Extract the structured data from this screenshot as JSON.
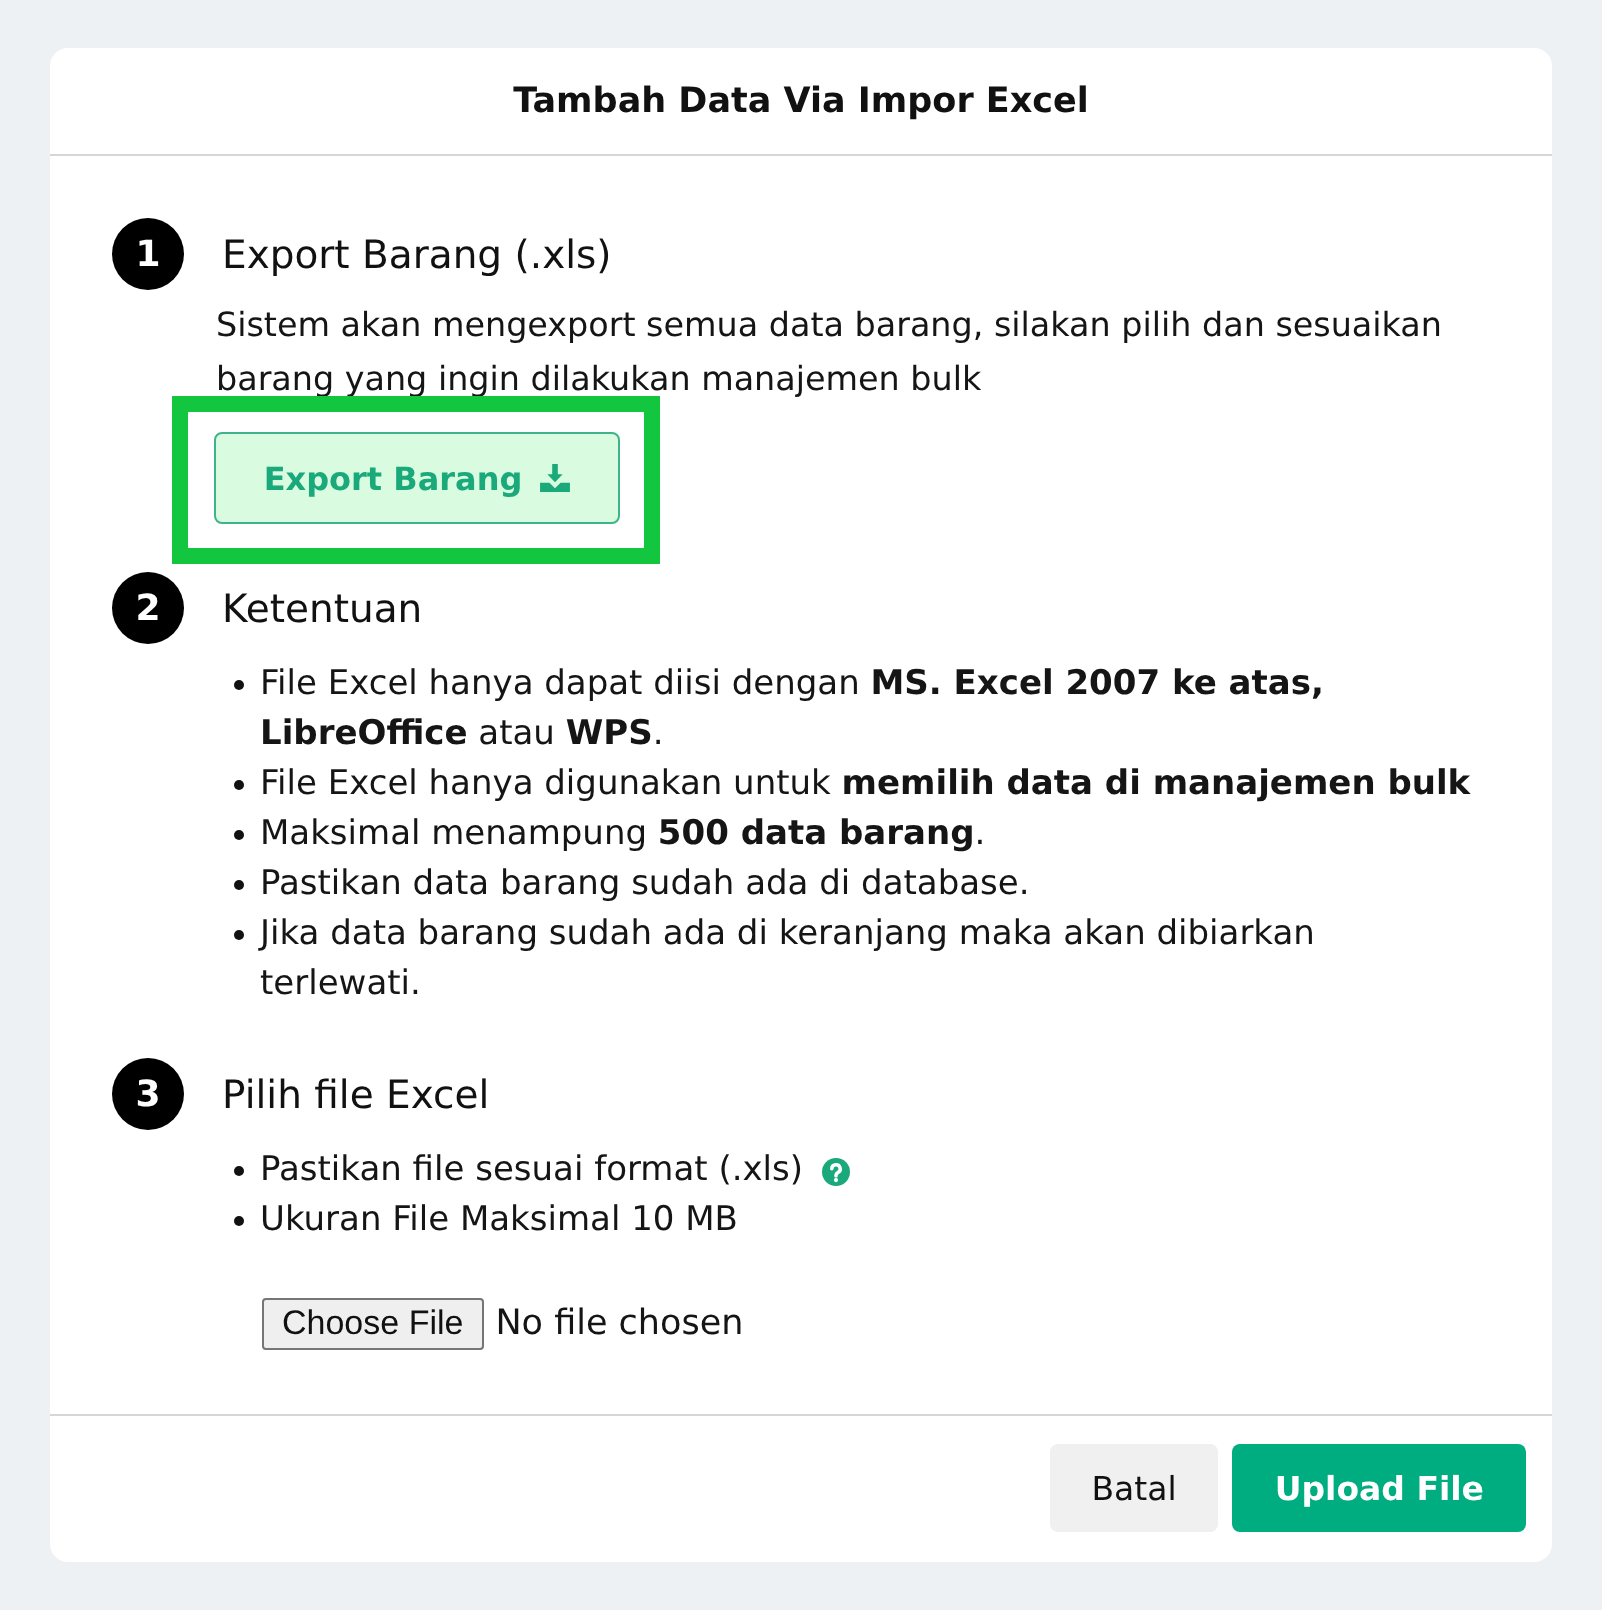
{
  "dialog": {
    "title": "Tambah Data Via Impor Excel"
  },
  "steps": [
    {
      "number": "1",
      "kind": "export",
      "title": "Export Barang (.xls)",
      "description": "Sistem akan mengexport semua data barang, silakan pilih dan sesuaikan barang yang ingin dilakukan manajemen bulk",
      "button": {
        "label": "Export Barang",
        "highlighted": true
      }
    },
    {
      "number": "2",
      "kind": "rules",
      "title": "Ketentuan",
      "items": [
        "File Excel hanya dapat diisi dengan **MS. Excel 2007 ke atas, LibreOffice** atau **WPS**.",
        "File Excel hanya digunakan untuk **memilih data di manajemen bulk**",
        "Maksimal menampung **500 data barang**.",
        "Pastikan data barang sudah ada di database.",
        "Jika data barang sudah ada di keranjang maka akan dibiarkan terlewati."
      ]
    },
    {
      "number": "3",
      "kind": "file",
      "title": "Pilih file Excel",
      "items": [
        {
          "text": "Pastikan file sesuai format (.xls)",
          "help": true
        },
        {
          "text": "Ukuran File Maksimal 10 MB",
          "help": false
        }
      ],
      "file_input": {
        "button": "Choose File",
        "status": "No file chosen"
      }
    }
  ],
  "footer": {
    "buttons": [
      {
        "label": "Batal",
        "kind": "secondary"
      },
      {
        "label": "Upload File",
        "kind": "primary"
      }
    ]
  }
}
